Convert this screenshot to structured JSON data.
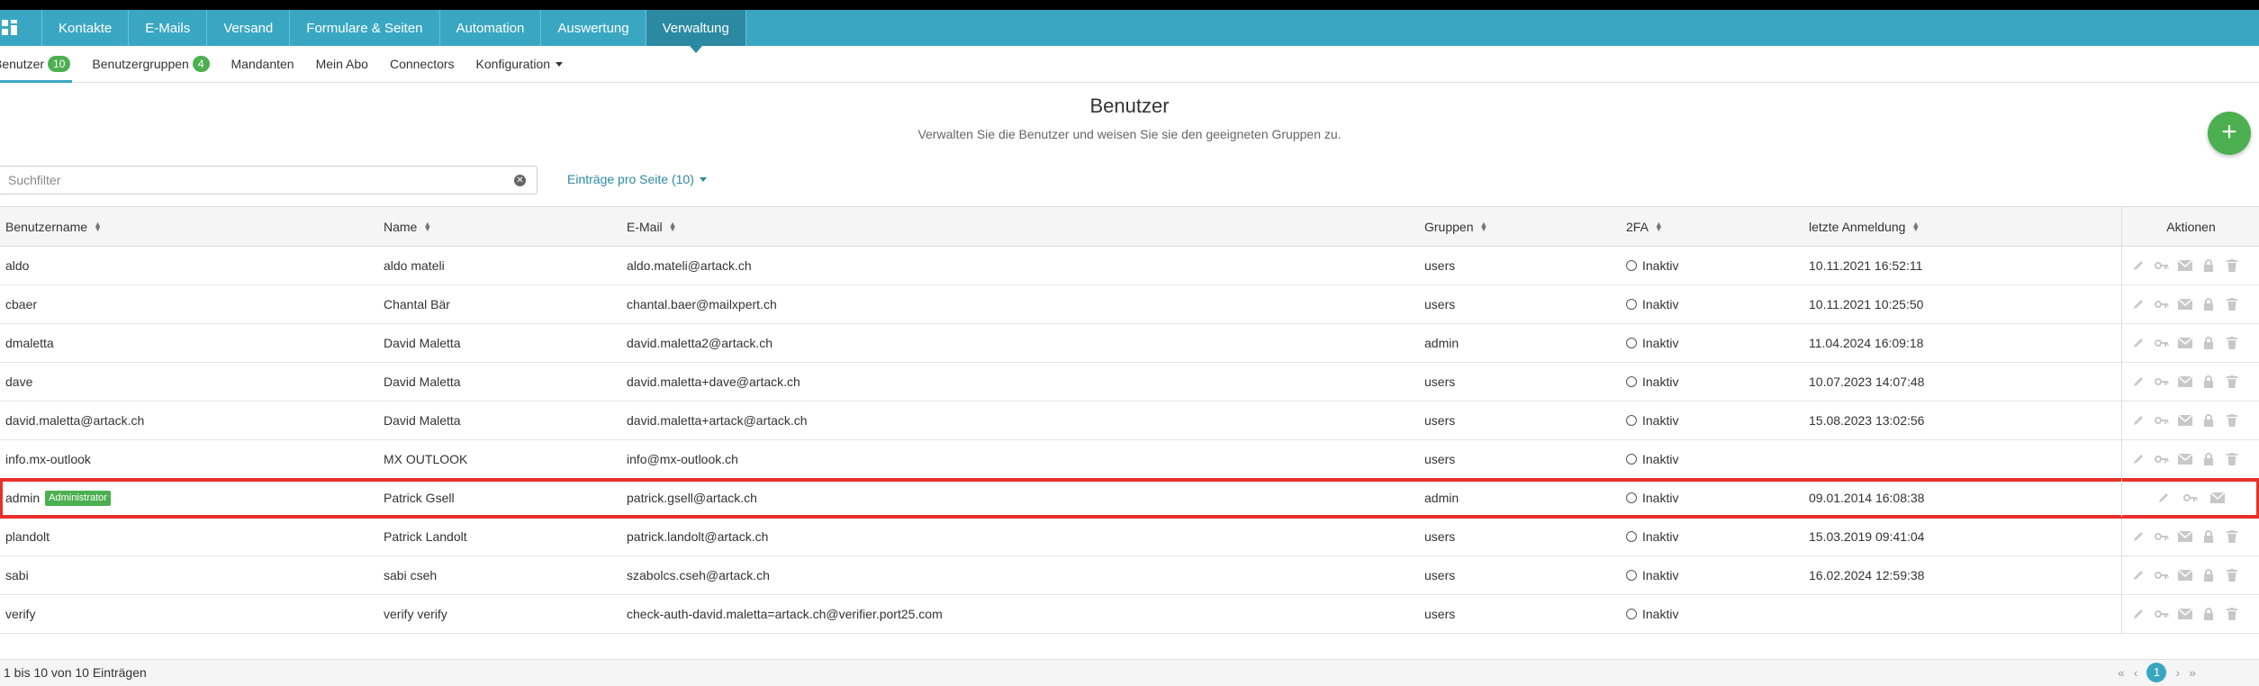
{
  "nav": {
    "items": [
      "Kontakte",
      "E-Mails",
      "Versand",
      "Formulare & Seiten",
      "Automation",
      "Auswertung",
      "Verwaltung"
    ],
    "active": "Verwaltung",
    "color": "#3aa7c2",
    "active_color": "#2b8aa1"
  },
  "subnav": {
    "benutzer": "Benutzer",
    "benutzer_count": "10",
    "gruppen": "Benutzergruppen",
    "gruppen_count": "4",
    "mandanten": "Mandanten",
    "abo": "Mein Abo",
    "connectors": "Connectors",
    "konfiguration": "Konfiguration"
  },
  "page": {
    "title": "Benutzer",
    "subtitle": "Verwalten Sie die Benutzer und weisen Sie sie den geeigneten Gruppen zu.",
    "add_button": "+"
  },
  "search": {
    "placeholder": "Suchfilter",
    "value": ""
  },
  "entries_per_page": "Einträge pro Seite (10)",
  "table": {
    "columns": {
      "username": "Benutzername",
      "name": "Name",
      "email": "E-Mail",
      "groups": "Gruppen",
      "twofa": "2FA",
      "last_login": "letzte Anmeldung",
      "actions": "Aktionen"
    },
    "rows": [
      {
        "username": "aldo",
        "badge": "",
        "name": "aldo mateli",
        "email": "aldo.mateli@artack.ch",
        "group": "users",
        "twofa": "Inaktiv",
        "last_login": "10.11.2021 16:52:11"
      },
      {
        "username": "cbaer",
        "badge": "",
        "name": "Chantal Bär",
        "email": "chantal.baer@mailxpert.ch",
        "group": "users",
        "twofa": "Inaktiv",
        "last_login": "10.11.2021 10:25:50"
      },
      {
        "username": "dmaletta",
        "badge": "",
        "name": "David Maletta",
        "email": "david.maletta2@artack.ch",
        "group": "admin",
        "twofa": "Inaktiv",
        "last_login": "11.04.2024 16:09:18"
      },
      {
        "username": "dave",
        "badge": "",
        "name": "David Maletta",
        "email": "david.maletta+dave@artack.ch",
        "group": "users",
        "twofa": "Inaktiv",
        "last_login": "10.07.2023 14:07:48"
      },
      {
        "username": "david.maletta@artack.ch",
        "badge": "",
        "name": "David Maletta",
        "email": "david.maletta+artack@artack.ch",
        "group": "users",
        "twofa": "Inaktiv",
        "last_login": "15.08.2023 13:02:56"
      },
      {
        "username": "info.mx-outlook",
        "badge": "",
        "name": "MX OUTLOOK",
        "email": "info@mx-outlook.ch",
        "group": "users",
        "twofa": "Inaktiv",
        "last_login": ""
      },
      {
        "username": "admin",
        "badge": "Administrator",
        "name": "Patrick Gsell",
        "email": "patrick.gsell@artack.ch",
        "group": "admin",
        "twofa": "Inaktiv",
        "last_login": "09.01.2014 16:08:38"
      },
      {
        "username": "plandolt",
        "badge": "",
        "name": "Patrick Landolt",
        "email": "patrick.landolt@artack.ch",
        "group": "users",
        "twofa": "Inaktiv",
        "last_login": "15.03.2019 09:41:04"
      },
      {
        "username": "sabi",
        "badge": "",
        "name": "sabi cseh",
        "email": "szabolcs.cseh@artack.ch",
        "group": "users",
        "twofa": "Inaktiv",
        "last_login": "16.02.2024 12:59:38"
      },
      {
        "username": "verify",
        "badge": "",
        "name": "verify verify",
        "email": "check-auth-david.maletta=artack.ch@verifier.port25.com",
        "group": "users",
        "twofa": "Inaktiv",
        "last_login": ""
      }
    ],
    "row_actions": [
      "pencil-icon",
      "key-icon",
      "envelope-icon",
      "lock-icon",
      "trash-icon"
    ],
    "admin_row_actions": [
      "pencil-icon",
      "key-icon",
      "envelope-icon"
    ]
  },
  "footer": {
    "info": "1 bis 10 von 10 Einträgen",
    "first": "«",
    "prev": "‹",
    "page": "1",
    "next": "›",
    "last": "»"
  }
}
